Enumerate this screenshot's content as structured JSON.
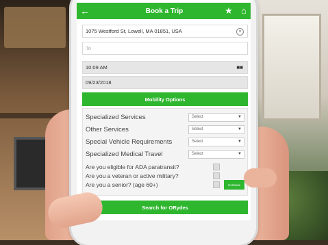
{
  "header": {
    "title": "Book a Trip",
    "back_icon": "arrow-left-icon",
    "fav_icon": "star-icon",
    "home_icon": "home-icon"
  },
  "form": {
    "from_value": "1075 Westford St, Lowell, MA 01851, USA",
    "to_placeholder": "To",
    "time_value": "10:09 AM",
    "date_value": "09/23/2018",
    "mobility_button": "Mobility Options"
  },
  "options": [
    {
      "label": "Specialized Services",
      "select": "Select"
    },
    {
      "label": "Other Services",
      "select": "Select"
    },
    {
      "label": "Special Vehicle Requirements",
      "select": "Select"
    },
    {
      "label": "Specialized Medical Travel",
      "select": "Select"
    }
  ],
  "questions": [
    {
      "label": "Are you eligible for ADA paratransit?"
    },
    {
      "label": "Are you a veteran or active military?"
    },
    {
      "label": "Are you a senior? (age 60+)"
    }
  ],
  "continue_label": "Continue",
  "search_button": "Search for ORydes",
  "colors": {
    "accent": "#2fb62f"
  }
}
